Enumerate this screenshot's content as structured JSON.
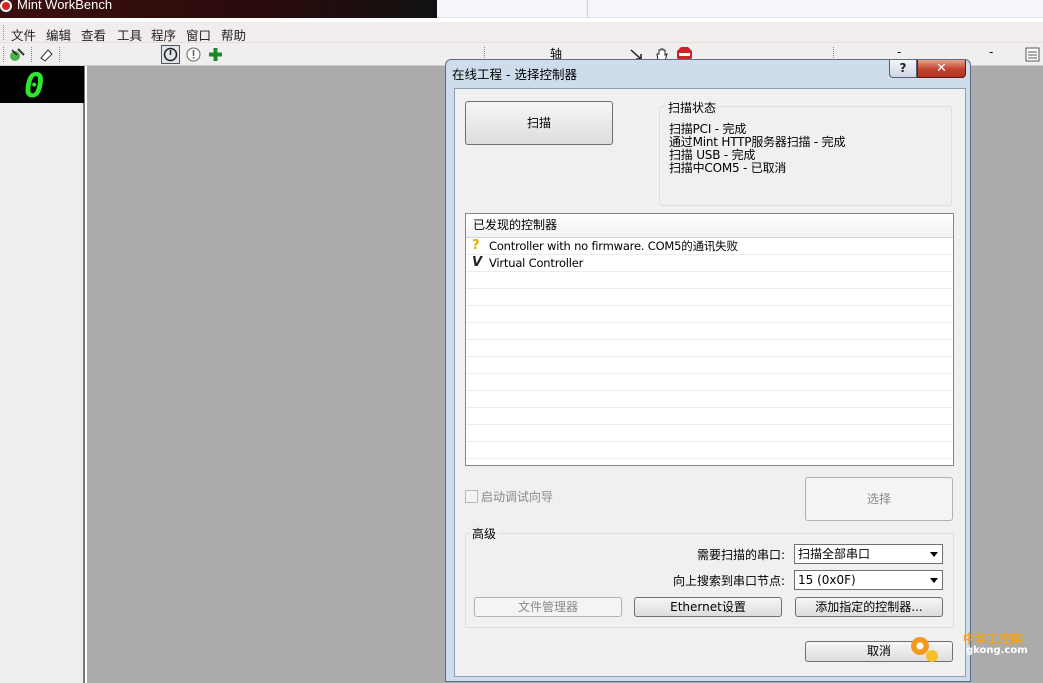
{
  "app": {
    "title": "Mint WorkBench",
    "display_digit": "0"
  },
  "menu": [
    "文件",
    "编辑",
    "查看",
    "工具",
    "程序",
    "窗口",
    "帮助"
  ],
  "toolbar": {
    "axis_label": "轴",
    "right_dashes": [
      "-",
      "-"
    ]
  },
  "dialog": {
    "title": "在线工程 - 选择控制器",
    "help_label": "?",
    "close_label": "✕",
    "scan_button": "扫描",
    "scan_status": {
      "title": "扫描状态",
      "lines": [
        "扫描PCI - 完成",
        "通过Mint HTTP服务器扫描 - 完成",
        "扫描 USB - 完成",
        "扫描中COM5 - 已取消"
      ]
    },
    "found": {
      "header": "已发现的控制器",
      "rows": [
        {
          "icon": "question-icon",
          "text": "Controller with no firmware. COM5的通讯失败"
        },
        {
          "icon": "virtual-v-icon",
          "text": "Virtual Controller"
        }
      ]
    },
    "debug_wizard_label": "启动调试向导",
    "select_button": "选择",
    "advanced": {
      "title": "高级",
      "port_label": "需要扫描的串口:",
      "port_value": "扫描全部串口",
      "node_label": "向上搜索到串口节点:",
      "node_value": "15  (0x0F)",
      "file_manager_button": "文件管理器",
      "ethernet_button": "Ethernet设置",
      "add_controller_button": "添加指定的控制器..."
    },
    "cancel_button": "取消"
  },
  "watermark": {
    "name": "中华工控网",
    "url": "gkong.com"
  },
  "colors": {
    "dialog_frame": "#cfdceb",
    "workspace": "#ababab",
    "display_green": "#2fe62f"
  }
}
